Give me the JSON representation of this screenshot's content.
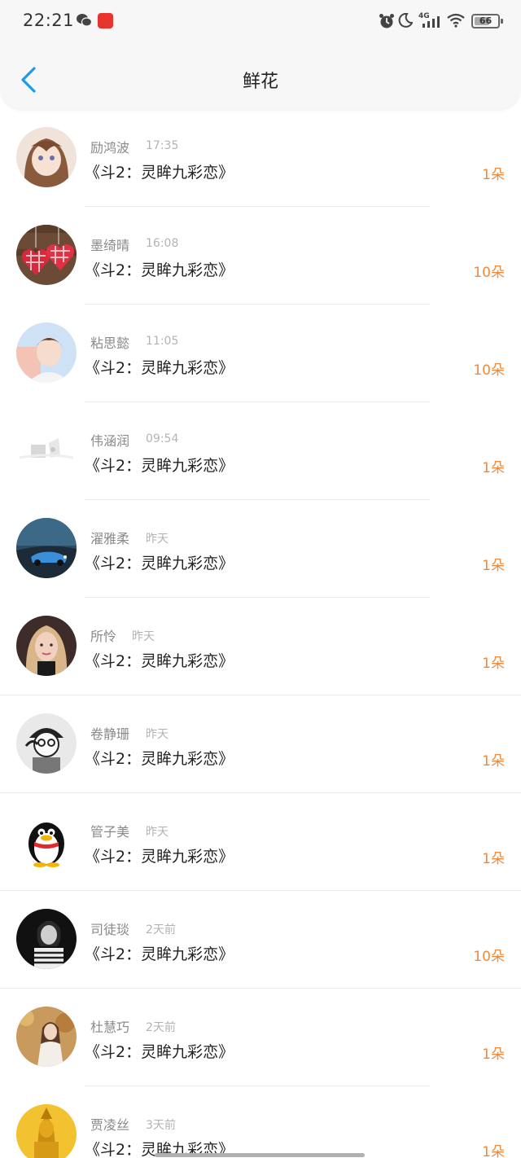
{
  "status_bar": {
    "time": "22:21",
    "battery": "66",
    "battery_level": 0.66,
    "signal_label": "4G"
  },
  "header": {
    "title": "鲜花"
  },
  "icons": {
    "back": "chevron-left-icon",
    "status": [
      "wechat-icon",
      "app-badge-icon",
      "alarm-icon",
      "moon-icon",
      "signal-icon",
      "wifi-icon",
      "battery-icon"
    ]
  },
  "colors": {
    "accent_back": "#1e9be6",
    "count_orange": "#ec8a40",
    "badge_red": "#e8342f"
  },
  "items": [
    {
      "name": "励鸿波",
      "time": "17:35",
      "book": "《斗2：灵眸九彩恋》",
      "count": "1朵",
      "avatar": "anime-girl-avatar"
    },
    {
      "name": "墨绮晴",
      "time": "16:08",
      "book": "《斗2：灵眸九彩恋》",
      "count": "10朵",
      "avatar": "plaid-hearts-avatar"
    },
    {
      "name": "粘思懿",
      "time": "11:05",
      "book": "《斗2：灵眸九彩恋》",
      "count": "10朵",
      "avatar": "young-man-avatar"
    },
    {
      "name": "伟涵润",
      "time": "09:54",
      "book": "《斗2：灵眸九彩恋》",
      "count": "1朵",
      "avatar": "faded-sketch-avatar"
    },
    {
      "name": "濯雅柔",
      "time": "昨天",
      "book": "《斗2：灵眸九彩恋》",
      "count": "1朵",
      "avatar": "car-night-avatar"
    },
    {
      "name": "所怜",
      "time": "昨天",
      "book": "《斗2：灵眸九彩恋》",
      "count": "1朵",
      "avatar": "blonde-woman-avatar"
    },
    {
      "name": "卷静珊",
      "time": "昨天",
      "book": "《斗2：灵眸九彩恋》",
      "count": "1朵",
      "avatar": "cartoon-boy-avatar"
    },
    {
      "name": "管子美",
      "time": "昨天",
      "book": "《斗2：灵眸九彩恋》",
      "count": "1朵",
      "avatar": "penguin-avatar"
    },
    {
      "name": "司徒琰",
      "time": "2天前",
      "book": "《斗2：灵眸九彩恋》",
      "count": "10朵",
      "avatar": "bw-woman-avatar"
    },
    {
      "name": "杜慧巧",
      "time": "2天前",
      "book": "《斗2：灵眸九彩恋》",
      "count": "1朵",
      "avatar": "autumn-woman-avatar"
    },
    {
      "name": "贾凌丝",
      "time": "3天前",
      "book": "《斗2：灵眸九彩恋》",
      "count": "1朵",
      "avatar": "golden-statue-avatar"
    }
  ]
}
